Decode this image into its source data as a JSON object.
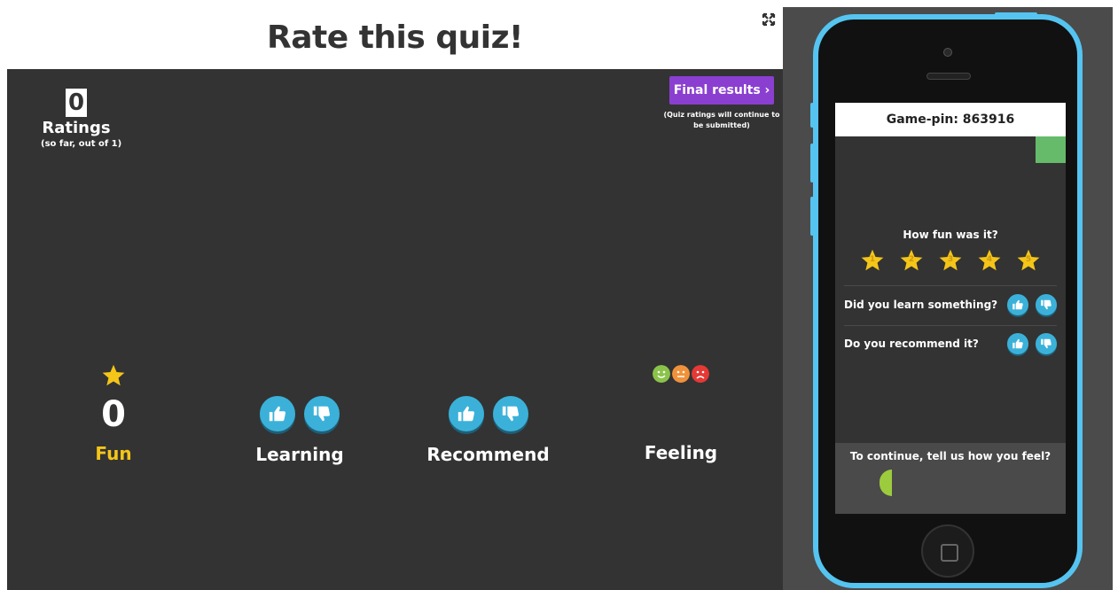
{
  "header": {
    "title": "Rate this quiz!"
  },
  "ratings": {
    "count": "0",
    "label": "Ratings",
    "sub": "(so far, out of 1)"
  },
  "final_results": {
    "label": "Final results ›",
    "note": "(Quiz ratings will continue to be submitted)"
  },
  "stats": {
    "fun": {
      "value": "0",
      "label": "Fun"
    },
    "learning": {
      "label": "Learning"
    },
    "recommend": {
      "label": "Recommend"
    },
    "feeling": {
      "label": "Feeling"
    }
  },
  "phone": {
    "game_pin": "Game-pin: 863916",
    "fun_question": "How fun was it?",
    "stars": [
      "1",
      "2",
      "3",
      "4",
      "5"
    ],
    "learn_question": "Did you learn something?",
    "recommend_question": "Do you recommend it?",
    "continue_text": "To continue, tell us how you feel?"
  },
  "colors": {
    "accent_purple": "#8a3fd1",
    "thumb_blue": "#3bb1d9",
    "star_yellow": "#f5c518",
    "phone_blue": "#55c4f0",
    "board_dark": "#333333",
    "face_happy": "#8bc34a",
    "face_neutral": "#f0923b",
    "face_sad": "#e53935"
  },
  "icons": {
    "fullscreen": "fullscreen-icon",
    "star": "star-icon",
    "thumbs_up": "thumbs-up-icon",
    "thumbs_down": "thumbs-down-icon",
    "smiley": "smiley-face-icon",
    "neutral": "neutral-face-icon",
    "sad": "sad-face-icon"
  }
}
